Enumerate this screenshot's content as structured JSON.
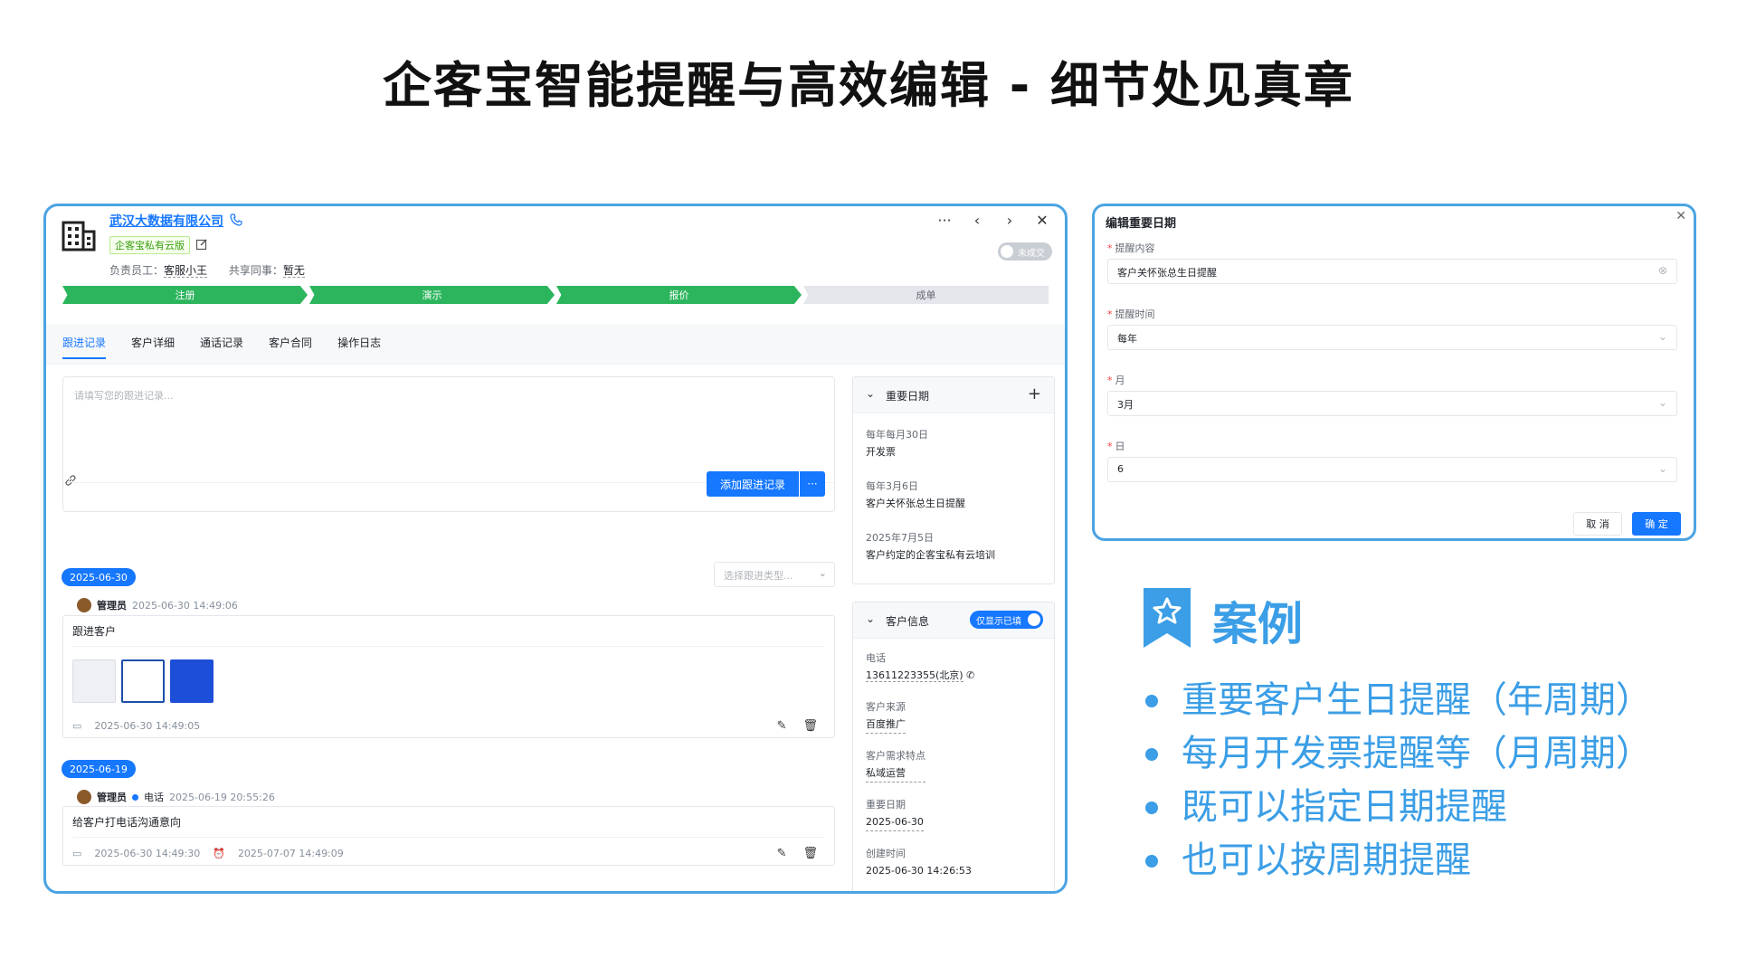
{
  "page": {
    "title": "企客宝智能提醒与高效编辑 - 细节处见真章"
  },
  "crm": {
    "company_name": "武汉大数据有限公司",
    "edition_badge": "企客宝私有云版",
    "owner_label": "负责员工：",
    "owner_value": "客服小王",
    "shared_label": "共享同事：",
    "shared_value": "暂无",
    "deal_toggle": "未成交",
    "stages": [
      {
        "label": "注册",
        "status": "done"
      },
      {
        "label": "演示",
        "status": "done"
      },
      {
        "label": "报价",
        "status": "done"
      },
      {
        "label": "成单",
        "status": "todo"
      }
    ],
    "tabs": [
      "跟进记录",
      "客户详细",
      "通话记录",
      "客户合同",
      "操作日志"
    ],
    "followup_placeholder": "请填写您的跟进记录...",
    "add_button": "添加跟进记录",
    "more_button": "···",
    "type_select_placeholder": "选择跟进类型...",
    "logs": [
      {
        "date_pill": "2025-06-30",
        "user": "管理员",
        "channel": "",
        "time": "2025-06-30 14:49:06",
        "text": "跟进客户",
        "foot_created": "2025-06-30 14:49:05",
        "foot_remind": ""
      },
      {
        "date_pill": "2025-06-19",
        "user": "管理员",
        "channel": "电话",
        "time": "2025-06-19 20:55:26",
        "text": "给客户打电话沟通意向",
        "foot_created": "2025-06-30 14:49:30",
        "foot_remind": "2025-07-07 14:49:09"
      }
    ],
    "important_dates": {
      "title": "重要日期",
      "items": [
        {
          "when": "每年每月30日",
          "what": "开发票"
        },
        {
          "when": "每年3月6日",
          "what": "客户关怀张总生日提醒"
        },
        {
          "when": "2025年7月5日",
          "what": "客户约定的企客宝私有云培训"
        }
      ]
    },
    "customer_info": {
      "title": "客户信息",
      "only_filled": "仅显示已填",
      "fields": [
        {
          "key": "电话",
          "value": "13611223355(北京)"
        },
        {
          "key": "客户来源",
          "value": "百度推广"
        },
        {
          "key": "客户需求特点",
          "value": "私域运营"
        },
        {
          "key": "重要日期",
          "value": "2025-06-30"
        },
        {
          "key": "创建时间",
          "value": "2025-06-30 14:26:53"
        }
      ]
    }
  },
  "dialog": {
    "title": "编辑重要日期",
    "fields": [
      {
        "label": "提醒内容",
        "value": "客户关怀张总生日提醒",
        "suffix": "⊗"
      },
      {
        "label": "提醒时间",
        "value": "每年",
        "suffix": "⌄"
      },
      {
        "label": "月",
        "value": "3月",
        "suffix": "⌄"
      },
      {
        "label": "日",
        "value": "6",
        "suffix": "⌄"
      }
    ],
    "cancel": "取 消",
    "ok": "确 定"
  },
  "case": {
    "title": "案例",
    "points": [
      "重要客户生日提醒（年周期）",
      "每月开发票提醒等（月周期）",
      "既可以指定日期提醒",
      "也可以按周期提醒"
    ]
  },
  "colors": {
    "accent": "#1677ff",
    "frame": "#4ba3e3",
    "stage_done": "#2db55d",
    "case_blue": "#3b9ee6"
  }
}
